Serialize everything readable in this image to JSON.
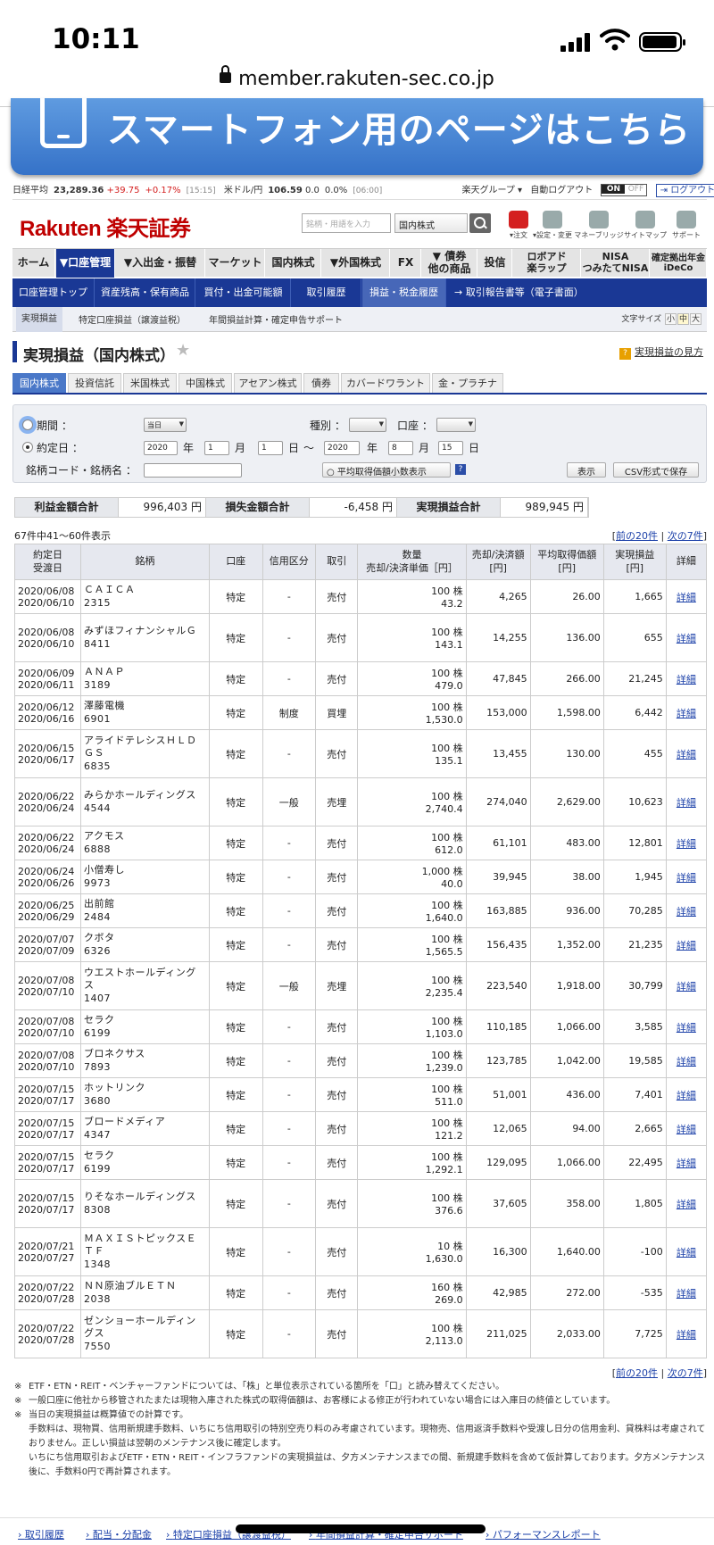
{
  "status": {
    "time": "10:11",
    "url": "member.rakuten-sec.co.jp"
  },
  "banner": {
    "text": "スマートフォン用のページはこちら"
  },
  "ticker": {
    "nikkei_label": "日経平均",
    "nikkei_value": "23,289.36",
    "nikkei_change": "+39.75",
    "nikkei_pct": "+0.17%",
    "nikkei_time": "[15:15]",
    "usd_label": "米ドル/円",
    "usd_value": "106.59",
    "usd_change": "0.0",
    "usd_pct": "0.0%",
    "usd_time": "[06:00]",
    "group": "楽天グループ ▾",
    "autologout": "自動ログアウト",
    "on": "ON",
    "off": "OFF",
    "logout": "ログアウト"
  },
  "header": {
    "logo": "Rakuten 楽天証券",
    "search_placeholder": "銘柄・用語を入力",
    "search_select": "国内株式",
    "icons": [
      {
        "label": "▾注文",
        "color": "#d42020"
      },
      {
        "label": "▾設定・変更",
        "color": "#888"
      },
      {
        "label": "マネーブリッジ",
        "color": "#888"
      },
      {
        "label": "サイトマップ",
        "color": "#888"
      },
      {
        "label": "サポート",
        "color": "#888"
      }
    ]
  },
  "nav": [
    "ホーム",
    "▼口座管理",
    "▼入出金・振替",
    "マーケット",
    "国内株式",
    "▼外国株式",
    "FX",
    "▼ 債券\n他の商品",
    "投信",
    "ロボアド\n楽ラップ",
    "NISA\nつみたてNISA",
    "確定拠出年金\niDeCo"
  ],
  "subnav": [
    "口座管理トップ",
    "資産残高・保有商品",
    "買付・出金可能額",
    "取引履歴",
    "損益・税金履歴",
    "→ 取引報告書等（電子書面）"
  ],
  "subsub": [
    "実現損益",
    "特定口座損益（譲渡益税）",
    "年間損益計算・確定申告サポート"
  ],
  "fontsize": {
    "label": "文字サイズ",
    "s": "小",
    "m": "中",
    "l": "大"
  },
  "page": {
    "title": "実現損益（国内株式）",
    "help": "実現損益の見方"
  },
  "tabs": [
    "国内株式",
    "投資信託",
    "米国株式",
    "中国株式",
    "アセアン株式",
    "債券",
    "カバードワラント",
    "金・プラチナ"
  ],
  "filter": {
    "period_label": "期間 ：",
    "period_value": "当日",
    "type_label": "種別 ：",
    "account_label": "口座 ：",
    "date_label": "約定日 ：",
    "from_year": "2020",
    "from_month": "1",
    "from_day": "1",
    "to_year": "2020",
    "to_month": "8",
    "to_day": "15",
    "year": "年",
    "month": "月",
    "day": "日",
    "tilde": "〜",
    "code_label": "銘柄コード・銘柄名 ：",
    "avg_button": "○ 平均取得価額小数表示",
    "show_button": "表示",
    "csv_button": "CSV形式で保存"
  },
  "summary": [
    {
      "label": "利益金額合計",
      "value": "996,403 円"
    },
    {
      "label": "損失金額合計",
      "value": "-6,458 円"
    },
    {
      "label": "実現損益合計",
      "value": "989,945 円"
    }
  ],
  "count": "67件中41〜60件表示",
  "pager": {
    "prev": "前の20件",
    "sep": " | ",
    "next": "次の7件"
  },
  "table_headers": [
    "約定日\n受渡日",
    "銘柄",
    "口座",
    "信用区分",
    "取引",
    "数量\n売却/決済単価［円］",
    "売却/決済額\n[円]",
    "平均取得価額\n[円]",
    "実現損益\n[円]",
    "詳細"
  ],
  "rows": [
    {
      "d1": "2020/06/08",
      "d2": "2020/06/10",
      "name": "ＣＡＩＣＡ",
      "code": "2315",
      "acct": "特定",
      "credit": "-",
      "trade": "売付",
      "qty": "100 株",
      "price": "43.2",
      "amount": "4,265",
      "avg": "26.00",
      "pl": "1,665",
      "detail": "詳細"
    },
    {
      "d1": "2020/06/08",
      "d2": "2020/06/10",
      "name": "みずほフィナンシャルＧ",
      "code": "8411",
      "acct": "特定",
      "credit": "-",
      "trade": "売付",
      "qty": "100 株",
      "price": "143.1",
      "amount": "14,255",
      "avg": "136.00",
      "pl": "655",
      "detail": "詳細",
      "tall": true
    },
    {
      "d1": "2020/06/09",
      "d2": "2020/06/11",
      "name": "ＡＮＡＰ",
      "code": "3189",
      "acct": "特定",
      "credit": "-",
      "trade": "売付",
      "qty": "100 株",
      "price": "479.0",
      "amount": "47,845",
      "avg": "266.00",
      "pl": "21,245",
      "detail": "詳細"
    },
    {
      "d1": "2020/06/12",
      "d2": "2020/06/16",
      "name": "澤藤電機",
      "code": "6901",
      "acct": "特定",
      "credit": "制度",
      "trade": "買埋",
      "qty": "100 株",
      "price": "1,530.0",
      "amount": "153,000",
      "avg": "1,598.00",
      "pl": "6,442",
      "detail": "詳細"
    },
    {
      "d1": "2020/06/15",
      "d2": "2020/06/17",
      "name": "アライドテレシスＨＬＤＧＳ",
      "code": "6835",
      "acct": "特定",
      "credit": "-",
      "trade": "売付",
      "qty": "100 株",
      "price": "135.1",
      "amount": "13,455",
      "avg": "130.00",
      "pl": "455",
      "detail": "詳細",
      "tall": true
    },
    {
      "d1": "2020/06/22",
      "d2": "2020/06/24",
      "name": "みらかホールディングス",
      "code": "4544",
      "acct": "特定",
      "credit": "一般",
      "trade": "売埋",
      "qty": "100 株",
      "price": "2,740.4",
      "amount": "274,040",
      "avg": "2,629.00",
      "pl": "10,623",
      "detail": "詳細",
      "tall": true
    },
    {
      "d1": "2020/06/22",
      "d2": "2020/06/24",
      "name": "アクモス",
      "code": "6888",
      "acct": "特定",
      "credit": "-",
      "trade": "売付",
      "qty": "100 株",
      "price": "612.0",
      "amount": "61,101",
      "avg": "483.00",
      "pl": "12,801",
      "detail": "詳細"
    },
    {
      "d1": "2020/06/24",
      "d2": "2020/06/26",
      "name": "小僧寿し",
      "code": "9973",
      "acct": "特定",
      "credit": "-",
      "trade": "売付",
      "qty": "1,000 株",
      "price": "40.0",
      "amount": "39,945",
      "avg": "38.00",
      "pl": "1,945",
      "detail": "詳細"
    },
    {
      "d1": "2020/06/25",
      "d2": "2020/06/29",
      "name": "出前館",
      "code": "2484",
      "acct": "特定",
      "credit": "-",
      "trade": "売付",
      "qty": "100 株",
      "price": "1,640.0",
      "amount": "163,885",
      "avg": "936.00",
      "pl": "70,285",
      "detail": "詳細"
    },
    {
      "d1": "2020/07/07",
      "d2": "2020/07/09",
      "name": "クボタ",
      "code": "6326",
      "acct": "特定",
      "credit": "-",
      "trade": "売付",
      "qty": "100 株",
      "price": "1,565.5",
      "amount": "156,435",
      "avg": "1,352.00",
      "pl": "21,235",
      "detail": "詳細"
    },
    {
      "d1": "2020/07/08",
      "d2": "2020/07/10",
      "name": "ウエストホールディングス",
      "code": "1407",
      "acct": "特定",
      "credit": "一般",
      "trade": "売埋",
      "qty": "100 株",
      "price": "2,235.4",
      "amount": "223,540",
      "avg": "1,918.00",
      "pl": "30,799",
      "detail": "詳細",
      "tall": true
    },
    {
      "d1": "2020/07/08",
      "d2": "2020/07/10",
      "name": "セラク",
      "code": "6199",
      "acct": "特定",
      "credit": "-",
      "trade": "売付",
      "qty": "100 株",
      "price": "1,103.0",
      "amount": "110,185",
      "avg": "1,066.00",
      "pl": "3,585",
      "detail": "詳細"
    },
    {
      "d1": "2020/07/08",
      "d2": "2020/07/10",
      "name": "ブロネクサス",
      "code": "7893",
      "acct": "特定",
      "credit": "-",
      "trade": "売付",
      "qty": "100 株",
      "price": "1,239.0",
      "amount": "123,785",
      "avg": "1,042.00",
      "pl": "19,585",
      "detail": "詳細"
    },
    {
      "d1": "2020/07/15",
      "d2": "2020/07/17",
      "name": "ホットリンク",
      "code": "3680",
      "acct": "特定",
      "credit": "-",
      "trade": "売付",
      "qty": "100 株",
      "price": "511.0",
      "amount": "51,001",
      "avg": "436.00",
      "pl": "7,401",
      "detail": "詳細"
    },
    {
      "d1": "2020/07/15",
      "d2": "2020/07/17",
      "name": "ブロードメディア",
      "code": "4347",
      "acct": "特定",
      "credit": "-",
      "trade": "売付",
      "qty": "100 株",
      "price": "121.2",
      "amount": "12,065",
      "avg": "94.00",
      "pl": "2,665",
      "detail": "詳細"
    },
    {
      "d1": "2020/07/15",
      "d2": "2020/07/17",
      "name": "セラク",
      "code": "6199",
      "acct": "特定",
      "credit": "-",
      "trade": "売付",
      "qty": "100 株",
      "price": "1,292.1",
      "amount": "129,095",
      "avg": "1,066.00",
      "pl": "22,495",
      "detail": "詳細"
    },
    {
      "d1": "2020/07/15",
      "d2": "2020/07/17",
      "name": "りそなホールディングス",
      "code": "8308",
      "acct": "特定",
      "credit": "-",
      "trade": "売付",
      "qty": "100 株",
      "price": "376.6",
      "amount": "37,605",
      "avg": "358.00",
      "pl": "1,805",
      "detail": "詳細",
      "tall": true
    },
    {
      "d1": "2020/07/21",
      "d2": "2020/07/27",
      "name": "ＭＡＸＩＳトピックスＥＴＦ",
      "code": "1348",
      "acct": "特定",
      "credit": "-",
      "trade": "売付",
      "qty": "10 株",
      "price": "1,630.0",
      "amount": "16,300",
      "avg": "1,640.00",
      "pl": "-100",
      "detail": "詳細",
      "tall": true
    },
    {
      "d1": "2020/07/22",
      "d2": "2020/07/28",
      "name": "ＮＮ原油ブルＥＴＮ",
      "code": "2038",
      "acct": "特定",
      "credit": "-",
      "trade": "売付",
      "qty": "160 株",
      "price": "269.0",
      "amount": "42,985",
      "avg": "272.00",
      "pl": "-535",
      "detail": "詳細"
    },
    {
      "d1": "2020/07/22",
      "d2": "2020/07/28",
      "name": "ゼンショーホールディングス",
      "code": "7550",
      "acct": "特定",
      "credit": "-",
      "trade": "売付",
      "qty": "100 株",
      "price": "2,113.0",
      "amount": "211,025",
      "avg": "2,033.00",
      "pl": "7,725",
      "detail": "詳細",
      "tall": true
    }
  ],
  "notes": [
    "ETF・ETN・REIT・ベンチャーファンドについては、「株」と単位表示されている箇所を「口」と読み替えてください。",
    "一般口座に他社から移管されたまたは現物入庫された株式の取得価額は、お客様による修正が行われていない場合には入庫日の終値としています。",
    "当日の実現損益は概算値での計算です。"
  ],
  "notes_extra": [
    "手数料は、現物買、信用新規建手数料、いちにち信用取引の特別空売り料のみ考慮されています。現物売、信用返済手数料や受渡し日分の信用金利、貸株料は考慮されておりません。正しい損益は翌朝のメンテナンス後に確定します。",
    "いちにち信用取引およびETF・ETN・REIT・インフラファンドの実現損益は、夕方メンテナンスまでの間、新規建手数料を含めて仮計算しております。夕方メンテナンス後に、手数料0円で再計算されます。"
  ],
  "footer": [
    "取引履歴",
    "配当・分配金",
    "特定口座損益（譲渡益税）",
    "年間損益計算・確定申告サポート",
    "パフォーマンスレポート"
  ]
}
